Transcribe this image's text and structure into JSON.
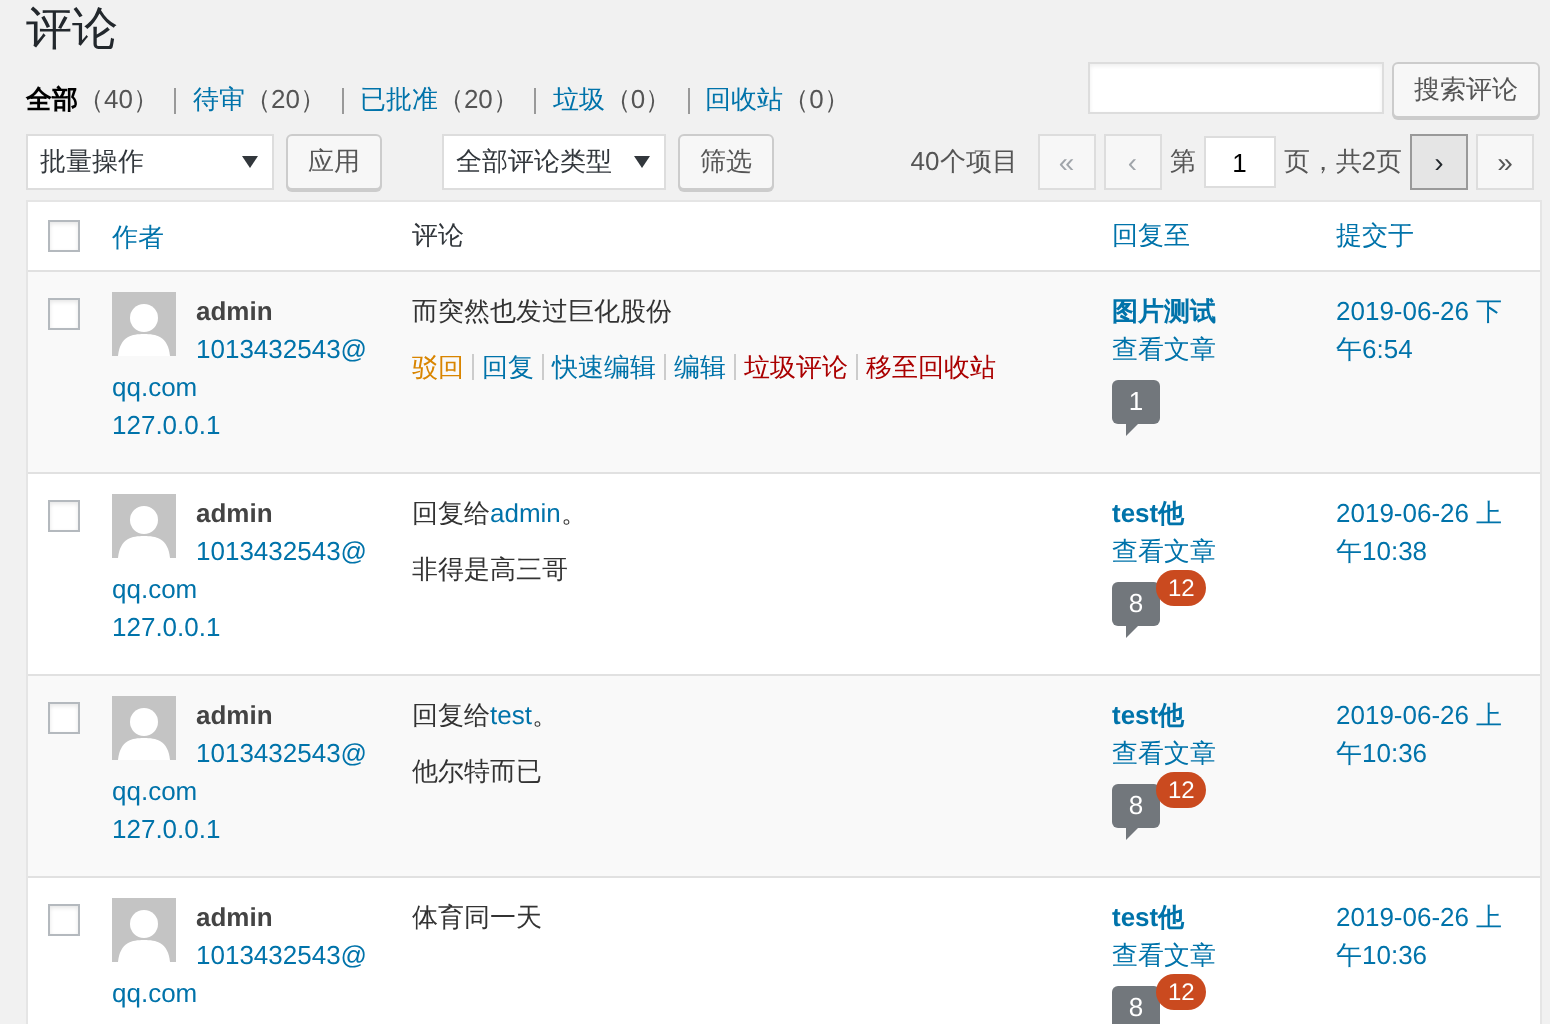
{
  "title": "评论",
  "filters": [
    {
      "label": "全部",
      "count": "（40）",
      "selected": true
    },
    {
      "label": "待审",
      "count": "（20）",
      "selected": false
    },
    {
      "label": "已批准",
      "count": "（20）",
      "selected": false
    },
    {
      "label": "垃圾",
      "count": "（0）",
      "selected": false
    },
    {
      "label": "回收站",
      "count": "（0）",
      "selected": false
    }
  ],
  "search": {
    "button": "搜索评论"
  },
  "bulk_actions": {
    "value": "批量操作",
    "button": "应用"
  },
  "type_filter": {
    "value": "全部评论类型",
    "button": "筛选"
  },
  "pagination": {
    "items": "40个项目",
    "first": {
      "label": "«",
      "disabled": true
    },
    "prev": {
      "label": "‹",
      "disabled": true
    },
    "page_prefix": "第",
    "page": "1",
    "page_suffix": "页，共2页",
    "next": {
      "label": "›",
      "disabled": false
    },
    "last": {
      "label": "»",
      "disabled": false
    }
  },
  "table": {
    "select_all_checked": false,
    "columns": [
      "作者",
      "评论",
      "回复至",
      "提交于"
    ],
    "rows": [
      {
        "checked": false,
        "author": "admin",
        "email": [
          "1013432543@",
          "qq.com"
        ],
        "ip": "127.0.0.1",
        "reply_to": null,
        "text": "而突然也发过巨化股份",
        "actions": [
          {
            "label": "驳回",
            "kind": "unapprove"
          },
          {
            "label": "回复",
            "kind": "normal"
          },
          {
            "label": "快速编辑",
            "kind": "normal"
          },
          {
            "label": "编辑",
            "kind": "normal"
          },
          {
            "label": "垃圾评论",
            "kind": "danger"
          },
          {
            "label": "移至回收站",
            "kind": "danger"
          }
        ],
        "post": "图片测试",
        "view": "查看文章",
        "approved": "1",
        "pending": null,
        "date": "2019-06-26 下午6:54"
      },
      {
        "checked": false,
        "author": "admin",
        "email": [
          "1013432543@",
          "qq.com"
        ],
        "ip": "127.0.0.1",
        "reply_to": {
          "prefix": "回复给",
          "name": "admin",
          "suffix": "。"
        },
        "text": "非得是高三哥",
        "actions": [],
        "post": "test他",
        "view": "查看文章",
        "approved": "8",
        "pending": "12",
        "date": "2019-06-26 上午10:38"
      },
      {
        "checked": false,
        "author": "admin",
        "email": [
          "1013432543@",
          "qq.com"
        ],
        "ip": "127.0.0.1",
        "reply_to": {
          "prefix": "回复给",
          "name": "test",
          "suffix": "。"
        },
        "text": "他尔特而已",
        "actions": [],
        "post": "test他",
        "view": "查看文章",
        "approved": "8",
        "pending": "12",
        "date": "2019-06-26 上午10:36"
      },
      {
        "checked": false,
        "author": "admin",
        "email": [
          "1013432543@",
          "qq.com"
        ],
        "ip": null,
        "reply_to": null,
        "text": "体育同一天",
        "actions": [],
        "post": "test他",
        "view": "查看文章",
        "approved": "8",
        "pending": "12",
        "date": "2019-06-26 上午10:36"
      }
    ]
  }
}
